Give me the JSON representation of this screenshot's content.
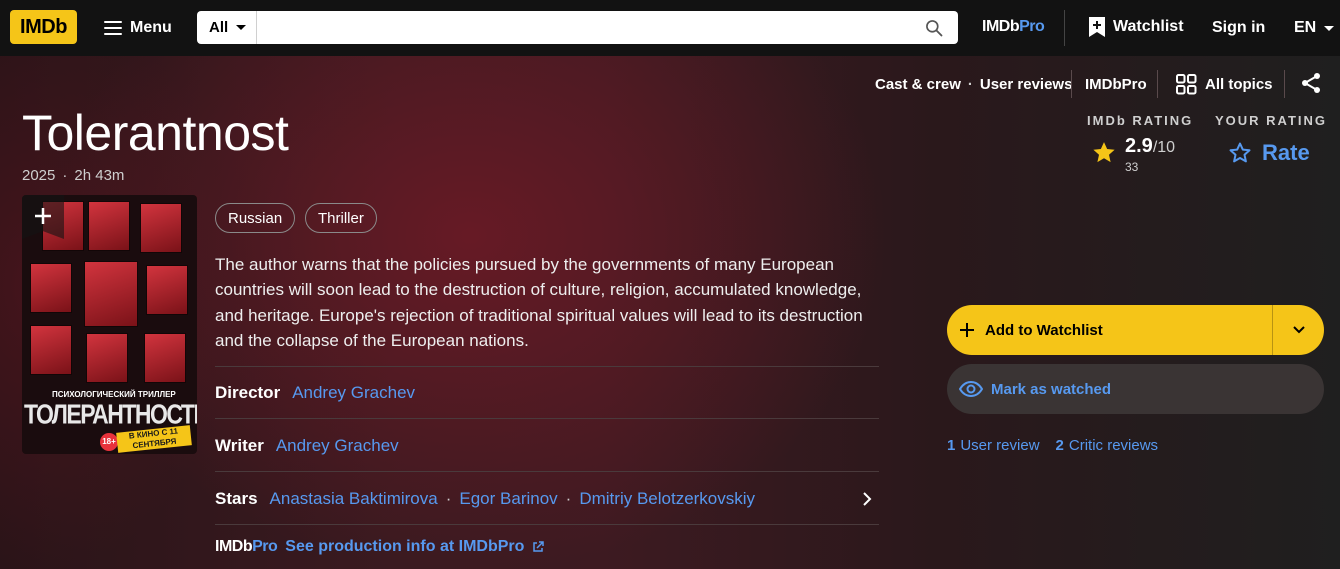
{
  "header": {
    "logo": "IMDb",
    "menu_label": "Menu",
    "search": {
      "category": "All",
      "value": "",
      "placeholder": ""
    },
    "pro_logo": {
      "imdb": "IMDb",
      "pro": "Pro"
    },
    "watchlist_label": "Watchlist",
    "signin_label": "Sign in",
    "language": "EN"
  },
  "subnav": {
    "cast_crew": "Cast & crew",
    "bullet": "·",
    "user_reviews": "User reviews",
    "imdbpro": "IMDbPro",
    "all_topics": "All topics"
  },
  "title": "Tolerantnost",
  "meta": {
    "year": "2025",
    "separator": "·",
    "runtime": "2h 43m"
  },
  "rating": {
    "imdb_label": "IMDb RATING",
    "value": "2.9",
    "scale": "/10",
    "count": "33",
    "your_label": "YOUR RATING",
    "rate_label": "Rate"
  },
  "poster": {
    "subtitle": "ПСИХОЛОГИЧЕСКИЙ ТРИЛЛЕР",
    "title": "ТОЛЕРАНТНОСТЬ",
    "date": "В КИНО С 11 СЕНТЯБРЯ",
    "age": "18+"
  },
  "genres": [
    "Russian",
    "Thriller"
  ],
  "plot": "The author warns that the policies pursued by the governments of many European countries will soon lead to the destruction of culture, religion, accumulated knowledge, and heritage. Europe's rejection of traditional spiritual values will lead to its destruction and the collapse of the European nations.",
  "credits": {
    "director": {
      "label": "Director",
      "names": [
        "Andrey Grachev"
      ]
    },
    "writer": {
      "label": "Writer",
      "names": [
        "Andrey Grachev"
      ]
    },
    "stars": {
      "label": "Stars",
      "names": [
        "Anastasia Baktimirova",
        "Egor Barinov",
        "Dmitriy Belotzerkovskiy"
      ],
      "separator": "·"
    }
  },
  "pro_link": {
    "brand_imdb": "IMDb",
    "brand_pro": "Pro",
    "text": "See production info at IMDbPro"
  },
  "actions": {
    "add_watchlist": "Add to Watchlist",
    "mark_watched": "Mark as watched"
  },
  "reviews": {
    "user_count": "1",
    "user_label": "User review",
    "critic_count": "2",
    "critic_label": "Critic reviews"
  },
  "colors": {
    "accent": "#f5c518",
    "link": "#5799ef",
    "bg": "#1f1f1f"
  },
  "icons": [
    "hamburger-icon",
    "search-icon",
    "watchlist-add-icon",
    "caret-down-icon",
    "all-topics-icon",
    "share-icon",
    "star-icon",
    "star-outline-icon",
    "plus-icon",
    "chevron-right-icon",
    "eye-icon",
    "external-link-icon"
  ]
}
